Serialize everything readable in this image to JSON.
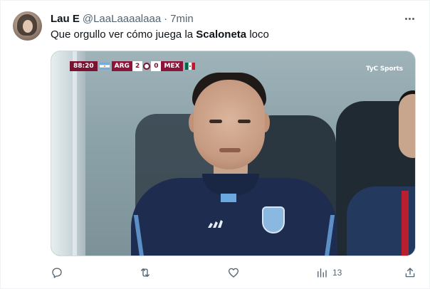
{
  "tweet": {
    "display_name": "Lau E",
    "handle": "@LaaLaaaalaaa",
    "separator": "·",
    "time": "7min",
    "text_before": "Que orgullo ver cómo juega la ",
    "text_bold": "Scaloneta",
    "text_after": " loco"
  },
  "media": {
    "scoreboard": {
      "clock": "88:20",
      "team_home": "ARG",
      "score_home": "2",
      "score_away": "0",
      "team_away": "MEX"
    },
    "watermark": "TyC Sports"
  },
  "actions": {
    "reply_icon": "reply-icon",
    "retweet_icon": "retweet-icon",
    "like_icon": "heart-icon",
    "views_icon": "views-chart-icon",
    "views_count": "13",
    "share_icon": "share-icon"
  },
  "colors": {
    "text_primary": "#0f1419",
    "text_secondary": "#536471",
    "border": "#cfd9de",
    "score_maroon": "#7a1232"
  }
}
